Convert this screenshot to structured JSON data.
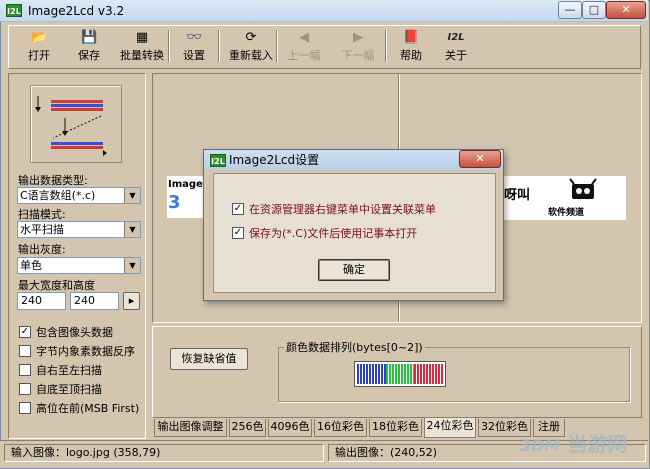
{
  "window": {
    "title": "Image2Lcd v3.2",
    "icon_text": "I2L",
    "controls": {
      "minimize": "—",
      "maximize": "□",
      "close": "✕"
    }
  },
  "toolbar": {
    "items": [
      {
        "label": "打开",
        "icon": "open-folder-icon",
        "glyph": "📂",
        "enabled": true
      },
      {
        "label": "保存",
        "icon": "save-disk-icon",
        "glyph": "💾",
        "enabled": true
      },
      {
        "label": "批量转换",
        "icon": "batch-convert-icon",
        "glyph": "▦",
        "enabled": true
      },
      {
        "label": "设置",
        "icon": "settings-glasses-icon",
        "glyph": "👓",
        "enabled": true
      },
      {
        "label": "重新载入",
        "icon": "reload-icon",
        "glyph": "⟳",
        "enabled": true
      },
      {
        "label": "上一幅",
        "icon": "previous-image-icon",
        "glyph": "◀",
        "enabled": false
      },
      {
        "label": "下一幅",
        "icon": "next-image-icon",
        "glyph": "▶",
        "enabled": false
      },
      {
        "label": "帮助",
        "icon": "help-book-icon",
        "glyph": "📕",
        "enabled": true
      },
      {
        "label": "关于",
        "icon": "about-i2l-icon",
        "glyph": "I2L",
        "enabled": true
      }
    ]
  },
  "left_panel": {
    "output_type_label": "输出数据类型:",
    "output_type_value": "C语言数组(*.c)",
    "scan_mode_label": "扫描模式:",
    "scan_mode_value": "水平扫描",
    "gray_label": "输出灰度:",
    "gray_value": "单色",
    "size_label": "最大宽度和高度",
    "max_width": "240",
    "max_height": "240",
    "size_button": "▸",
    "options": [
      {
        "label": "包含图像头数据",
        "checked": true
      },
      {
        "label": "字节内象素数据反序",
        "checked": false
      },
      {
        "label": "自右至左扫描",
        "checked": false
      },
      {
        "label": "自底至顶扫描",
        "checked": false
      },
      {
        "label": "高位在前(MSB First)",
        "checked": false
      }
    ]
  },
  "bottom_panel": {
    "restore_button": "恢复缺省值",
    "color_group_label": "颜色数据排列(bytes[0~2])"
  },
  "tabs": [
    "输出图像调整",
    "256色",
    "4096色",
    "16位彩色",
    "18位彩色",
    "24位彩色",
    "32位彩色",
    "注册"
  ],
  "active_tab": 5,
  "status": {
    "input": "输入图像：logo.jpg (358,79)",
    "output": "输出图像：(240,52)"
  },
  "watermark": "当游网",
  "preview_texts": {
    "left_logo": "Image",
    "right_logo": "软件频道",
    "right_fragment": "呀叫"
  },
  "dialog": {
    "title": "Image2Lcd设置",
    "icon_text": "I2L",
    "close": "✕",
    "options": [
      {
        "label": "在资源管理器右键菜单中设置关联菜单",
        "checked": true
      },
      {
        "label": "保存为(*.C)文件后使用记事本打开",
        "checked": true
      }
    ],
    "ok_button": "确定"
  },
  "colors": {
    "bar_blue": "#2b3fd8",
    "bar_green": "#22c33a",
    "bar_red": "#e0283c",
    "dialog_text": "#7a1020"
  }
}
